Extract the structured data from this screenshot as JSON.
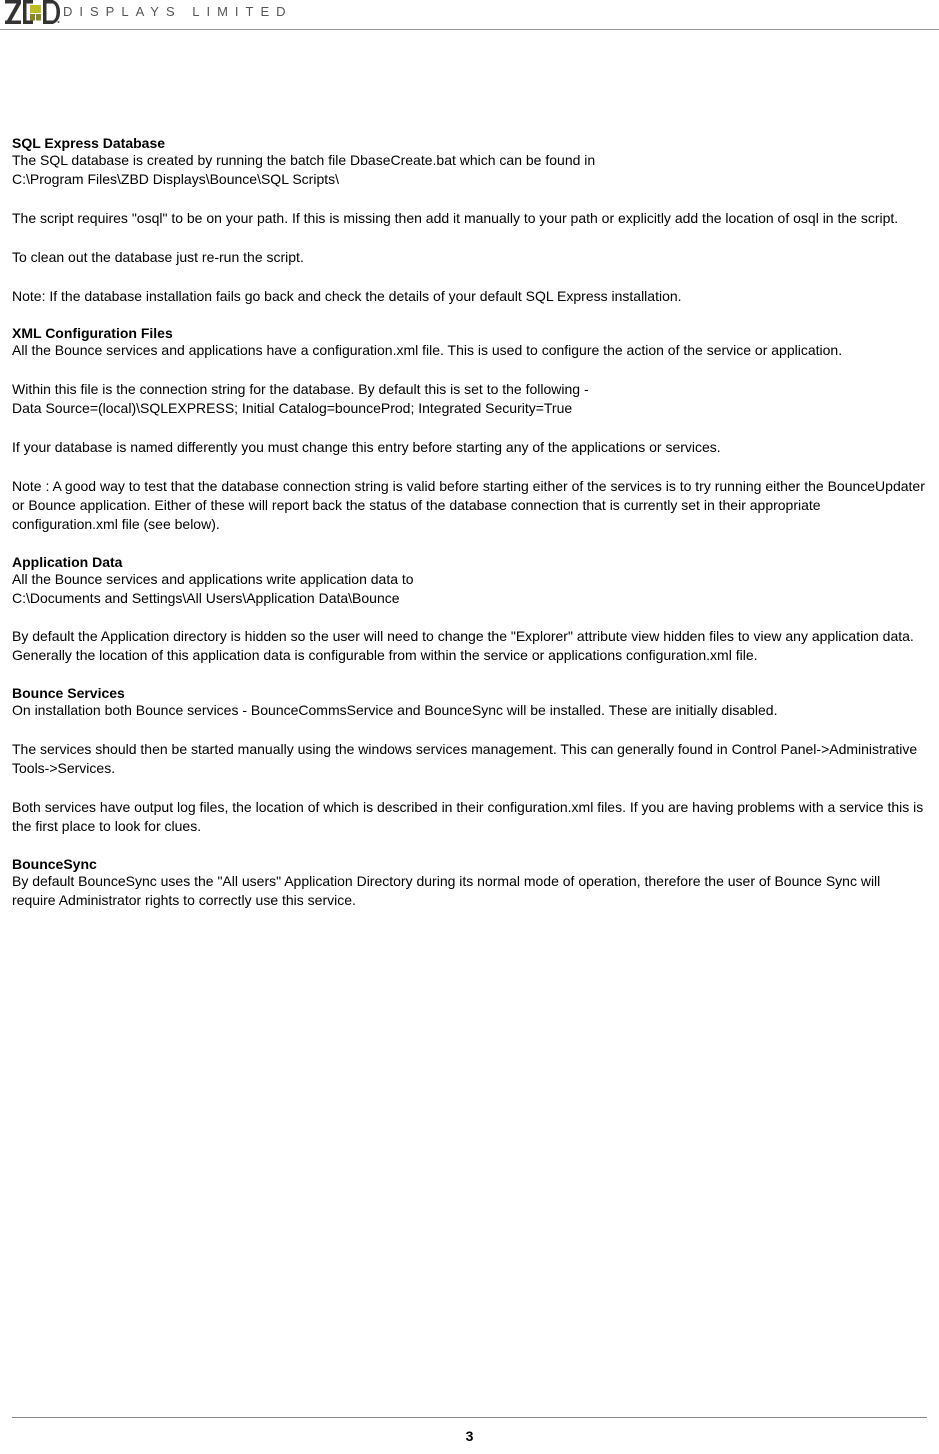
{
  "header": {
    "company": "DISPLAYS LIMITED"
  },
  "sections": {
    "sql": {
      "heading": "SQL Express Database",
      "p1": "The SQL database is created by running the batch file DbaseCreate.bat which can be found in",
      "p2": "C:\\Program Files\\ZBD Displays\\Bounce\\SQL Scripts\\",
      "p3": "The script requires \"osql\" to be on your path. If this is missing then add it manually to your path or explicitly add the location of osql in the script.",
      "p4": "To clean out the database just re-run the script.",
      "p5": "Note: If the database installation fails go back and check the details of your default SQL Express installation."
    },
    "xml": {
      "heading": "XML Configuration Files",
      "p1": "All the Bounce services and applications have a configuration.xml file. This is used to configure the action of the service or application.",
      "p2": "Within this file is the connection string for the database. By default this is set to the following -",
      "p3": "Data Source=(local)\\SQLEXPRESS; Initial Catalog=bounceProd; Integrated Security=True",
      "p4": "If your database is named differently you must change this entry before starting any of the applications or services.",
      "p5": "Note : A good way to test that the  database connection string is valid before starting either of the services is to try running either the BounceUpdater or Bounce application. Either of these will report back the status of the database connection that is currently set in their appropriate configuration.xml file (see below)."
    },
    "appdata": {
      "heading": "Application Data",
      "p1": "All the Bounce services and applications write application data to",
      "p2": "C:\\Documents and Settings\\All Users\\Application Data\\Bounce",
      "p3": "By default the Application directory is hidden so the user will need to change the \"Explorer\" attribute view hidden files to view any application data.",
      "p4": "Generally the location of this application data is configurable from within the service or applications configuration.xml file."
    },
    "services": {
      "heading": "Bounce Services",
      "p1": "On installation both Bounce services - BounceCommsService and BounceSync will be installed. These are initially disabled.",
      "p2": "The services should then be started manually using the windows services management. This can generally found in Control Panel->Administrative Tools->Services.",
      "p3": "Both services have output log files, the location of which is described in their configuration.xml files. If you are having problems with a service this is the first place to look for clues."
    },
    "sync": {
      "heading": "BounceSync",
      "p1": "By default BounceSync uses the \"All users\" Application Directory during its normal mode of operation, therefore the user of Bounce Sync will require Administrator rights to correctly use this service."
    }
  },
  "footer": {
    "page": "3"
  }
}
